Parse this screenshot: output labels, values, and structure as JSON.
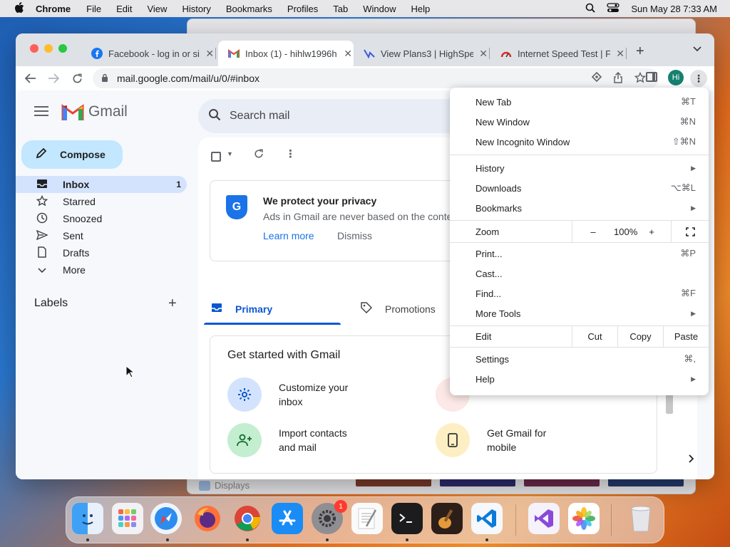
{
  "menubar": {
    "app": "Chrome",
    "items": [
      "File",
      "Edit",
      "View",
      "History",
      "Bookmarks",
      "Profiles",
      "Tab",
      "Window",
      "Help"
    ],
    "datetime": "Sun May 28  7:33 AM"
  },
  "background_window": {
    "label": "Displays"
  },
  "tabs": [
    {
      "title": "Facebook - log in or si",
      "favicon": "facebook-icon"
    },
    {
      "title": "Inbox (1) - hihlw1996h",
      "favicon": "gmail-icon"
    },
    {
      "title": "View Plans3 | HighSpe",
      "favicon": "highspeed-icon"
    },
    {
      "title": "Internet Speed Test | F",
      "favicon": "speedtest-icon"
    }
  ],
  "toolbar": {
    "url": "mail.google.com/mail/u/0/#inbox",
    "profile_initials": "Hi"
  },
  "gmail": {
    "logo_text": "Gmail",
    "compose_label": "Compose",
    "search_placeholder": "Search mail",
    "nav": [
      {
        "label": "Inbox",
        "icon": "inbox-icon",
        "count": "1"
      },
      {
        "label": "Starred",
        "icon": "star-icon",
        "count": ""
      },
      {
        "label": "Snoozed",
        "icon": "clock-icon",
        "count": ""
      },
      {
        "label": "Sent",
        "icon": "send-icon",
        "count": ""
      },
      {
        "label": "Drafts",
        "icon": "draft-icon",
        "count": ""
      },
      {
        "label": "More",
        "icon": "chevron-down-icon",
        "count": ""
      }
    ],
    "labels_heading": "Labels",
    "privacy": {
      "title": "We protect your privacy",
      "description": "Ads in Gmail are never based on the conte",
      "learn_more": "Learn more",
      "dismiss": "Dismiss"
    },
    "category_tabs": [
      {
        "label": "Primary",
        "icon": "inbox-icon"
      },
      {
        "label": "Promotions",
        "icon": "tag-icon"
      }
    ],
    "get_started": {
      "title": "Get started with Gmail",
      "items": [
        {
          "label": "Customize your inbox",
          "icon": "gear-icon"
        },
        {
          "label": "Import contacts and mail",
          "icon": "add-person-icon"
        },
        {
          "label": "Get Gmail for mobile",
          "icon": "phone-icon"
        }
      ]
    }
  },
  "chrome_menu": {
    "new_tab": {
      "label": "New Tab",
      "shortcut": "⌘T"
    },
    "new_window": {
      "label": "New Window",
      "shortcut": "⌘N"
    },
    "new_incognito": {
      "label": "New Incognito Window",
      "shortcut": "⇧⌘N"
    },
    "history": {
      "label": "History"
    },
    "downloads": {
      "label": "Downloads",
      "shortcut": "⌥⌘L"
    },
    "bookmarks": {
      "label": "Bookmarks"
    },
    "zoom": {
      "label": "Zoom",
      "minus": "–",
      "level": "100%",
      "plus": "+"
    },
    "print": {
      "label": "Print...",
      "shortcut": "⌘P"
    },
    "cast": {
      "label": "Cast..."
    },
    "find": {
      "label": "Find...",
      "shortcut": "⌘F"
    },
    "more_tools": {
      "label": "More Tools"
    },
    "edit": {
      "label": "Edit",
      "cut": "Cut",
      "copy": "Copy",
      "paste": "Paste"
    },
    "settings": {
      "label": "Settings",
      "shortcut": "⌘,"
    },
    "help": {
      "label": "Help"
    }
  },
  "dock": {
    "apps": [
      "finder-icon",
      "launchpad-icon",
      "safari-icon",
      "firefox-icon",
      "chrome-icon",
      "app-store-icon",
      "system-settings-icon",
      "textedit-icon",
      "terminal-icon",
      "garageband-icon",
      "vscode-icon",
      "visual-studio-icon",
      "photos-icon",
      "trash-icon"
    ],
    "settings_badge": "1"
  }
}
